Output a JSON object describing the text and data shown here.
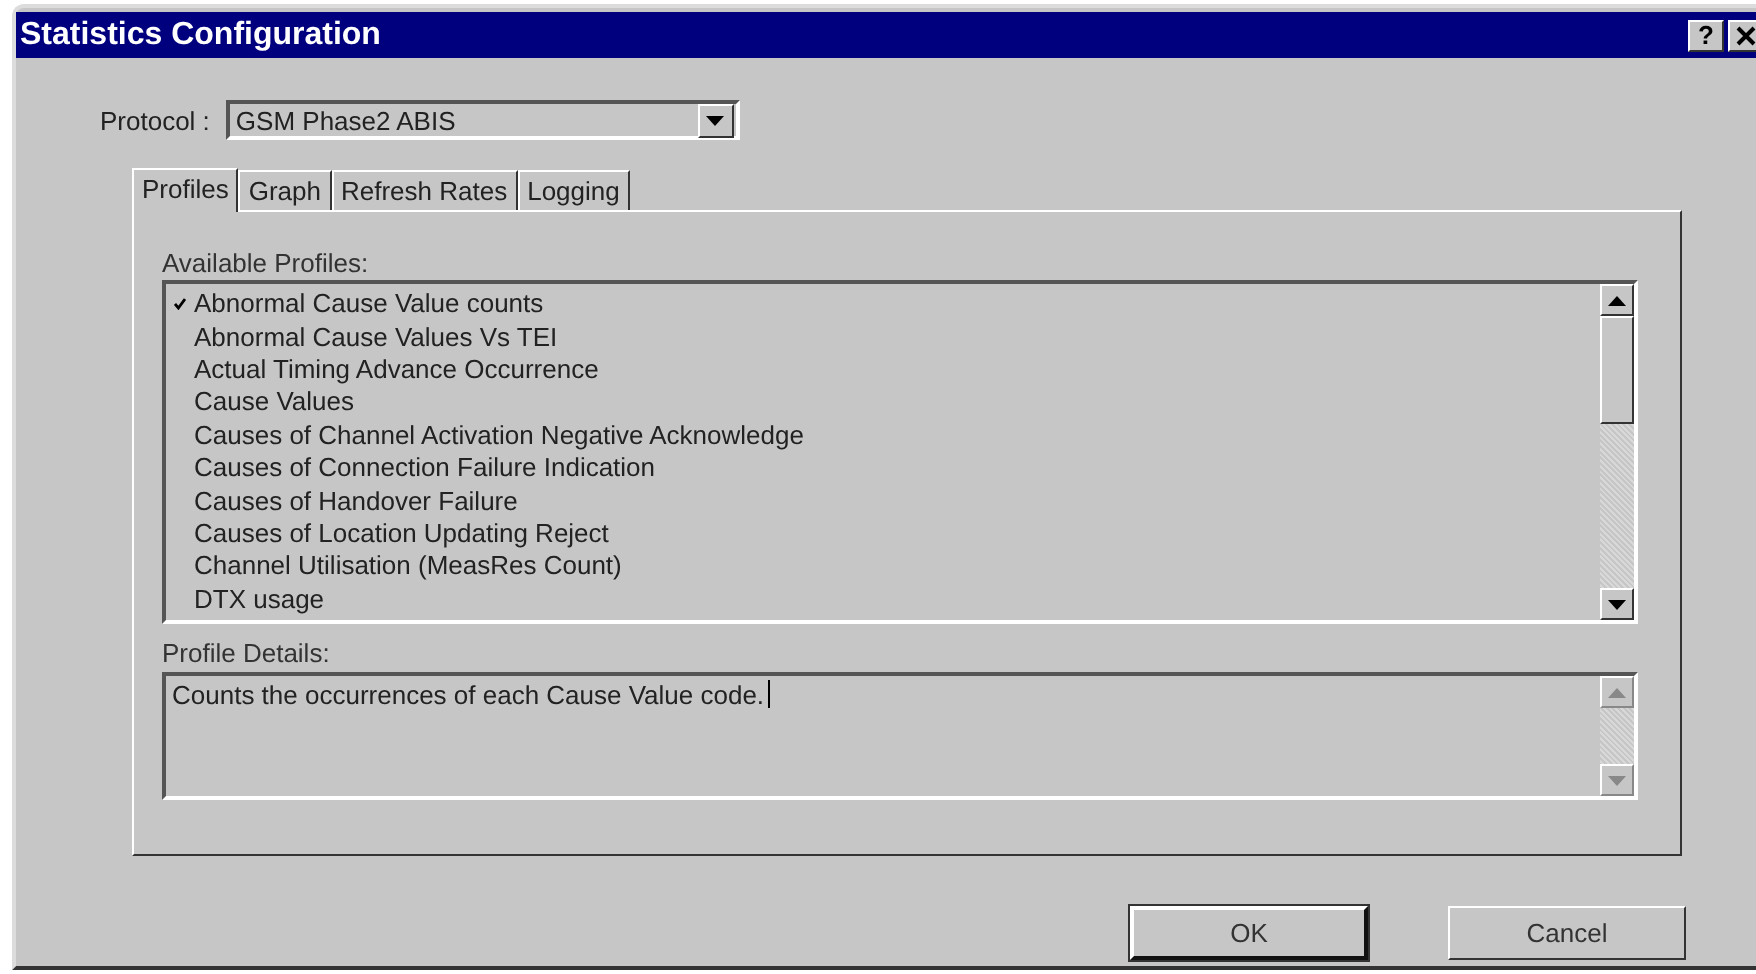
{
  "window": {
    "title": "Statistics Configuration",
    "help_button": "?"
  },
  "protocol": {
    "label": "Protocol :",
    "value": "GSM Phase2 ABIS"
  },
  "tabs": [
    {
      "label": "Profiles",
      "selected": true
    },
    {
      "label": "Graph",
      "selected": false
    },
    {
      "label": "Refresh Rates",
      "selected": false
    },
    {
      "label": "Logging",
      "selected": false
    }
  ],
  "available_profiles": {
    "label": "Available Profiles:",
    "items": [
      {
        "label": "Abnormal Cause Value counts",
        "checked": true
      },
      {
        "label": "Abnormal Cause Values Vs TEI",
        "checked": false
      },
      {
        "label": "Actual Timing Advance Occurrence",
        "checked": false
      },
      {
        "label": "Cause Values",
        "checked": false
      },
      {
        "label": "Causes of Channel Activation Negative Acknowledge",
        "checked": false
      },
      {
        "label": "Causes of Connection Failure Indication",
        "checked": false
      },
      {
        "label": "Causes of Handover Failure",
        "checked": false
      },
      {
        "label": "Causes of Location Updating Reject",
        "checked": false
      },
      {
        "label": "Channel Utilisation (MeasRes Count)",
        "checked": false
      },
      {
        "label": "DTX usage",
        "checked": false
      }
    ]
  },
  "profile_details": {
    "label": "Profile Details:",
    "value": "Counts the occurrences of each Cause Value code."
  },
  "buttons": [
    "OK",
    "Cancel"
  ]
}
